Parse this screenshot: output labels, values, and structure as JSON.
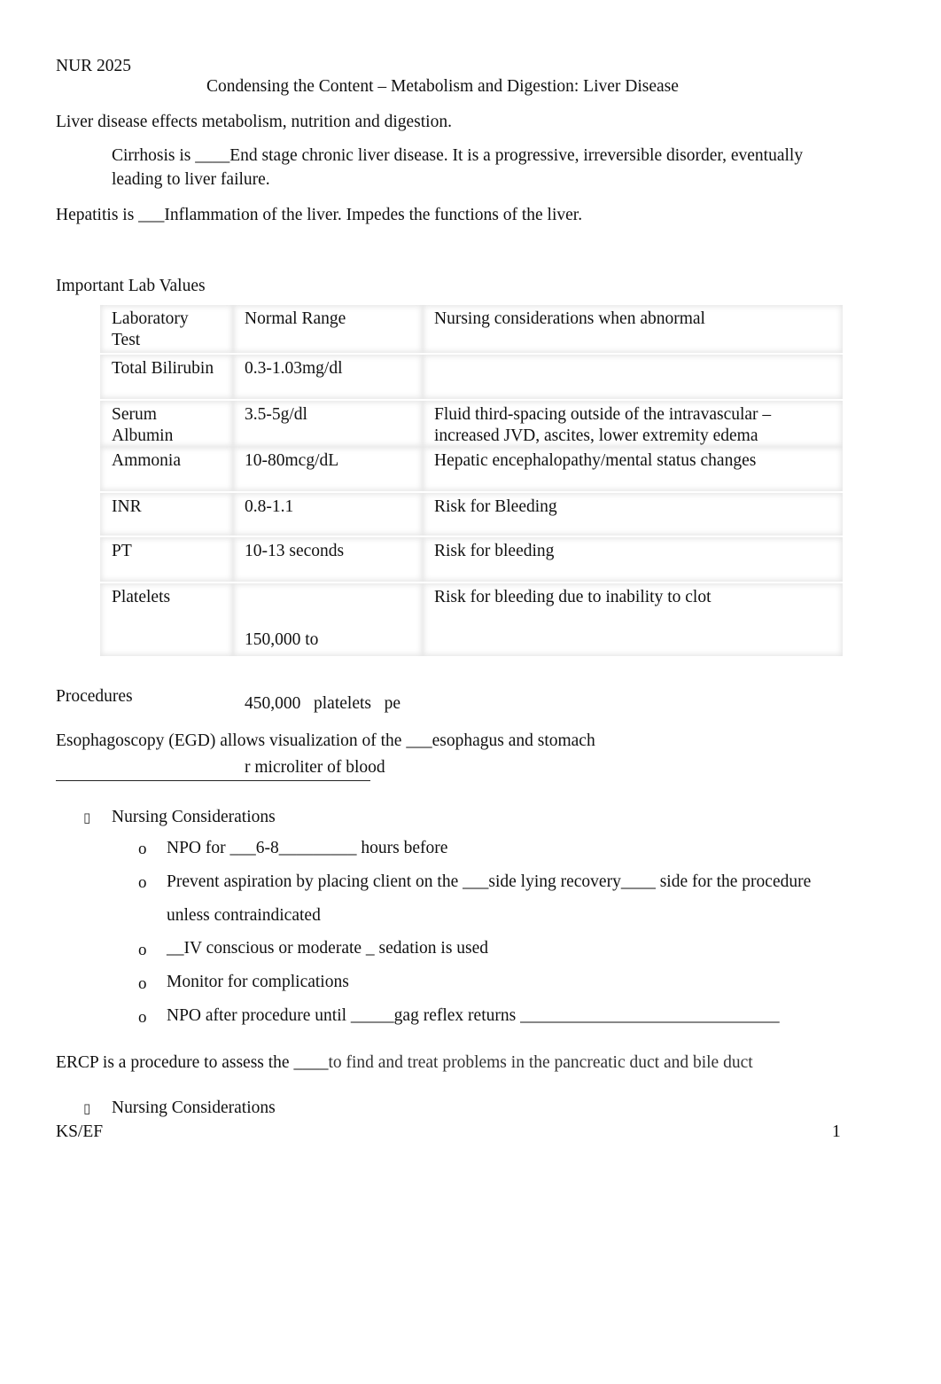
{
  "header": {
    "course": "NUR 2025",
    "title": "Condensing the Content – Metabolism and Digestion: Liver Disease"
  },
  "intro": {
    "line": "Liver disease effects metabolism, nutrition and digestion.",
    "cirrhosis_line1": "Cirrhosis is ____End stage chronic liver disease. It is a progressive, irreversible disorder, eventually",
    "cirrhosis_line2": "leading to liver failure.",
    "hepatitis": "Hepatitis is ___Inflammation of the liver. Impedes the functions of the liver."
  },
  "labs": {
    "heading": "Important Lab Values",
    "columns": [
      "Laboratory Test",
      "Normal Range",
      "Nursing considerations when abnormal"
    ],
    "header_col1_line1": "Laboratory",
    "header_col1_line2": "Test",
    "rows": [
      {
        "test": "Total Bilirubin",
        "range": "0.3-1.03mg/dl",
        "nursing": ""
      },
      {
        "test_line1": "Serum",
        "test_line2": "Albumin",
        "range": "3.5-5g/dl",
        "nursing_line1": "Fluid third-spacing outside of the intravascular –",
        "nursing_line2": "increased JVD, ascites, lower extremity edema"
      },
      {
        "test": "Ammonia",
        "range": "10-80mcg/dL",
        "nursing": "Hepatic encephalopathy/mental status changes"
      },
      {
        "test": "INR",
        "range": "0.8-1.1",
        "nursing": "Risk for Bleeding"
      },
      {
        "test": "PT",
        "range": "10-13 seconds",
        "nursing": "Risk for bleeding"
      },
      {
        "test": "Platelets",
        "range_line1": "150,000 to",
        "range_line2": "450,000   platelets   pe",
        "range_line3": "r microliter of blood",
        "nursing": "Risk for bleeding due to inability to clot"
      }
    ]
  },
  "procedures": {
    "heading": "Procedures",
    "egd": {
      "text": "Esophagoscopy (EGD) allows visualization of the ___esophagus and stomach",
      "sub_heading": "Nursing Considerations",
      "items": [
        "NPO for ___6-8_________ hours before",
        "Prevent aspiration by placing client on the ___side lying recovery____ side for the procedure",
        "unless contraindicated",
        "__IV conscious or moderate _ sedation is used",
        "Monitor for complications",
        "NPO after procedure until _____gag reflex returns ______________________________"
      ]
    },
    "ercp": {
      "text_start": "ERCP is a procedure to assess the ____",
      "text_end": "to find and treat problems in the pancreatic duct and bile duct",
      "sub_heading": "Nursing Considerations"
    }
  },
  "footer": {
    "initials": "KS/EF",
    "page_number": "1"
  },
  "icons": {
    "square_bullet": "▯",
    "circle_bullet": "o"
  }
}
